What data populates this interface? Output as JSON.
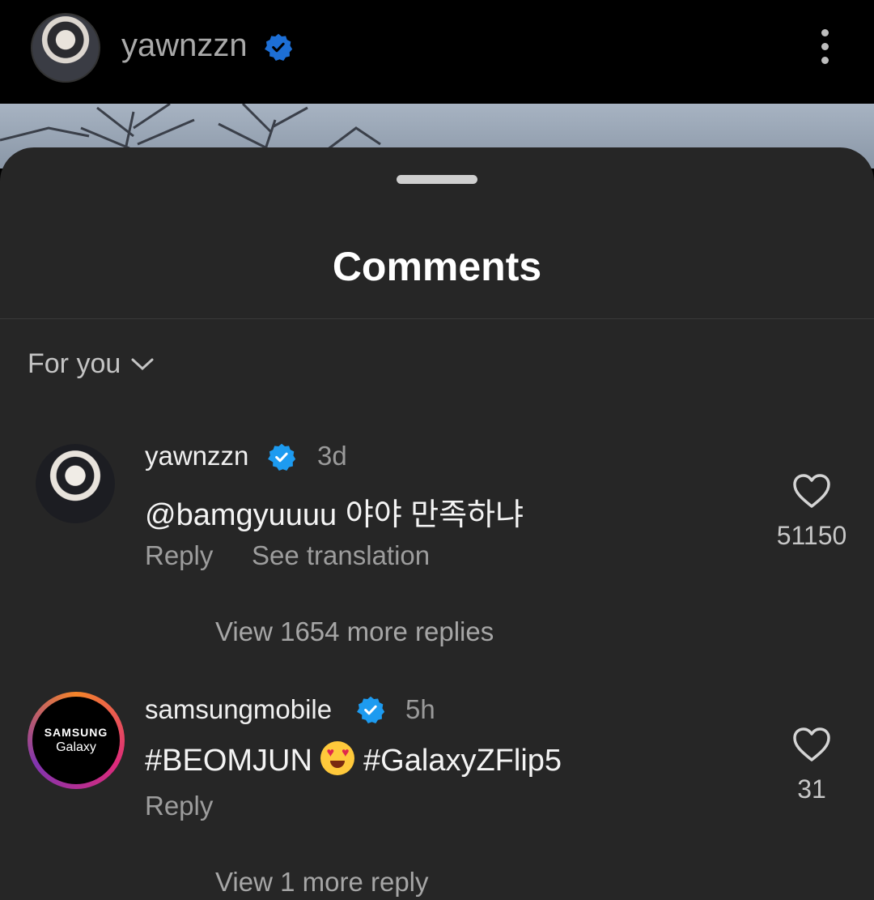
{
  "header": {
    "username": "yawnzzn",
    "verified": true,
    "menu_icon": "more-vertical-icon"
  },
  "sheet": {
    "title": "Comments",
    "sort_label": "For you"
  },
  "comments": [
    {
      "username": "yawnzzn",
      "verified": true,
      "time": "3d",
      "text_mention": "@bamgyuuuu",
      "text_body": "야야 만족하냐",
      "reply_label": "Reply",
      "translation_label": "See translation",
      "likes": "51150",
      "view_more": "View 1654 more replies"
    },
    {
      "username": "samsungmobile",
      "verified": true,
      "time": "5h",
      "avatar_brand": "SAMSUNG",
      "avatar_sub": "Galaxy",
      "text_tag1": "#BEOMJUN",
      "emoji": "heart-eyes-emoji",
      "text_tag2": "#GalaxyZFlip5",
      "reply_label": "Reply",
      "likes": "31",
      "view_more": "View 1 more reply"
    }
  ],
  "colors": {
    "verified_badge": "#1d9bf0",
    "sheet_bg": "#262626",
    "header_bg": "#000000"
  }
}
